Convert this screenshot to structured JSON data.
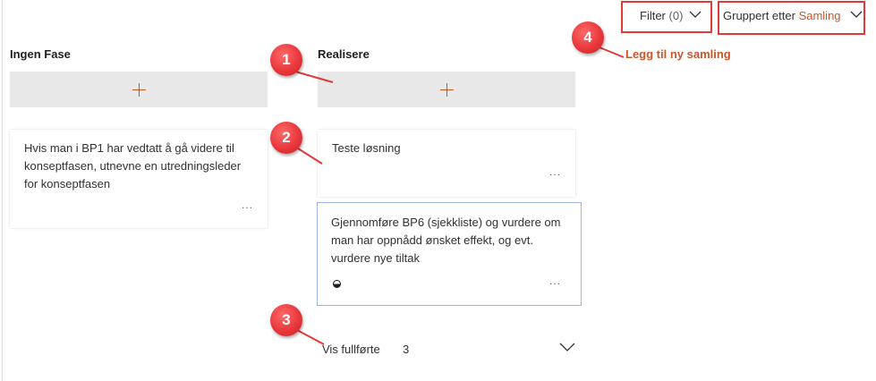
{
  "toolbar": {
    "filter_label": "Filter",
    "filter_count": "(0)",
    "group_by_label": "Gruppert etter",
    "group_by_value": "Samling",
    "add_group_link": "Legg til ny samling"
  },
  "columns": [
    {
      "title": "Ingen Fase",
      "cards": [
        {
          "title": "Hvis man i BP1 har vedtatt å gå videre til konseptfasen, utnevne en utredningsleder for konseptfasen",
          "more": "..."
        }
      ]
    },
    {
      "title": "Realisere",
      "cards": [
        {
          "title": "Teste løsning",
          "more": "..."
        },
        {
          "title": "Gjennomføre BP6 (sjekkliste) og vurdere om man har oppnådd ønsket effekt, og evt. vurdere nye tiltak",
          "more": "...",
          "progress": "half"
        }
      ],
      "completed_label": "Vis fullførte",
      "completed_count": "3"
    }
  ],
  "callouts": [
    "1",
    "2",
    "3",
    "4"
  ],
  "colors": {
    "accent": "#c8572a",
    "highlight": "#e03a3a",
    "selected_border": "#9ab7e8",
    "add_bar": "#e8e8e8"
  }
}
